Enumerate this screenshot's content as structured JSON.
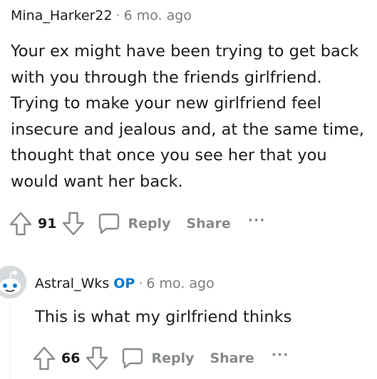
{
  "comments": [
    {
      "author": "Mina_Harker22",
      "separator": "·",
      "time": "6 mo. ago",
      "body": "Your ex might have been trying to get back\nwith you through the friends girlfriend.\nTrying to make your new girlfriend feel\ninsecure and jealous and, at the same time,\nthought that once you see her that you\nwould want her back.",
      "votes": "91",
      "reply_label": "Reply",
      "share_label": "Share",
      "more_label": "···"
    },
    {
      "author": "Astral_Wks",
      "op_badge": "OP",
      "separator": "·",
      "time": "6 mo. ago",
      "body": "This is what my girlfriend thinks",
      "votes": "66",
      "reply_label": "Reply",
      "share_label": "Share",
      "more_label": "···"
    }
  ],
  "icons": {
    "upvote": "upvote-arrow-icon",
    "downvote": "downvote-arrow-icon",
    "reply": "comment-bubble-icon",
    "avatar": "reddit-snoo-avatar-icon"
  },
  "colors": {
    "text": "#1c1c1c",
    "muted": "#878a8c",
    "op": "#0079d3",
    "thread_line": "#edeff1"
  }
}
